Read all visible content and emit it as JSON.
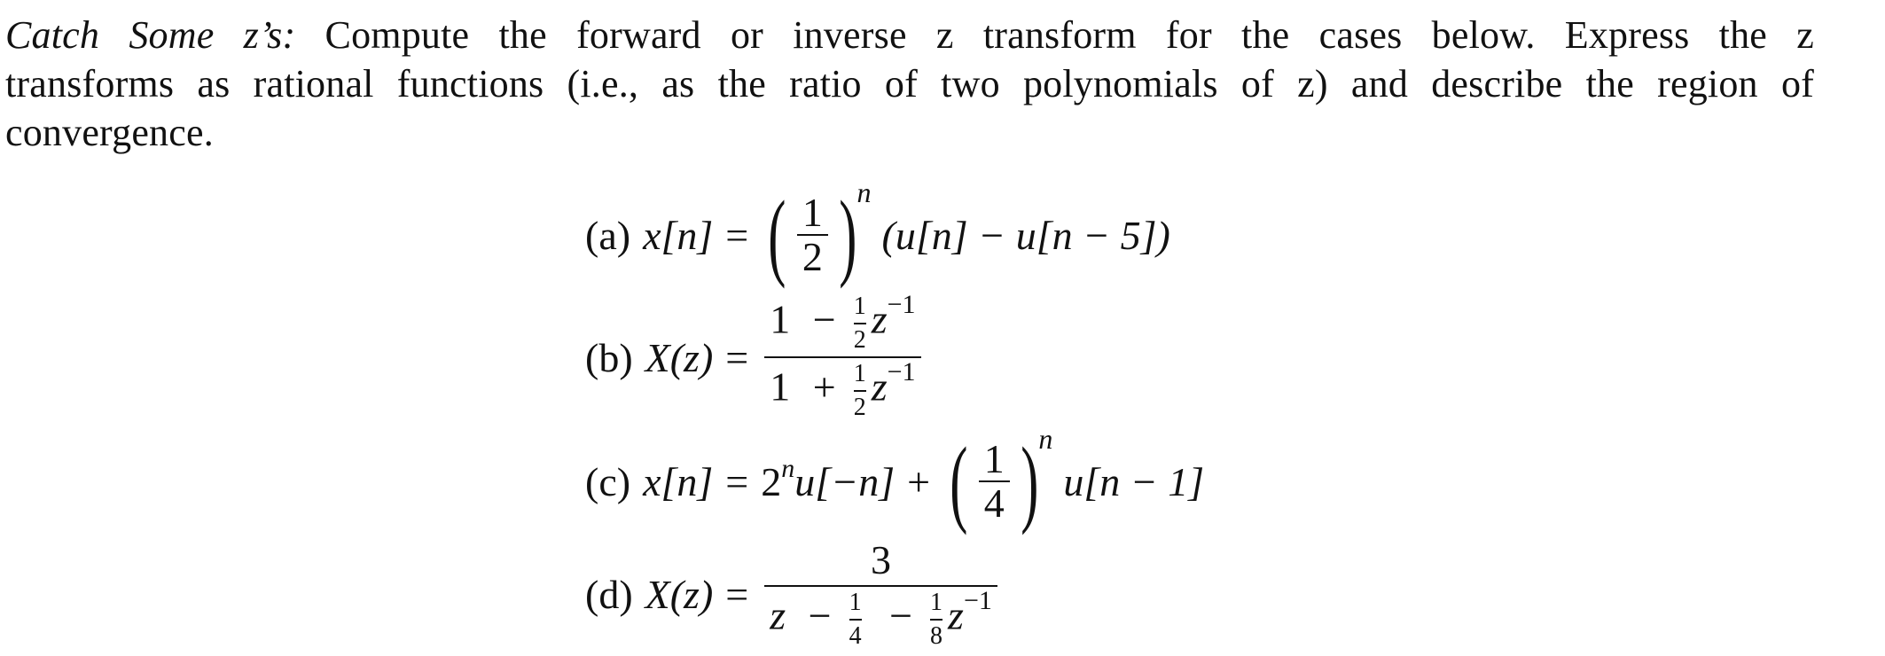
{
  "problem": {
    "lead_title": "Catch Some z’s:",
    "intro_lines": [
      "Compute the forward or inverse z transform for the cases below.  Express the z",
      "transforms as rational functions (i.e., as the ratio of two polynomials of z) and describe the region of",
      "convergence."
    ]
  },
  "parts": {
    "a": {
      "label": "(a)",
      "lhs": "x[n]",
      "equals": "=",
      "base_num": "1",
      "base_den": "2",
      "exponent": "n",
      "rest": "(u[n] − u[n − 5])"
    },
    "b": {
      "label": "(b)",
      "lhs": "X(z)",
      "equals": "=",
      "num_lead": "1",
      "num_op": "−",
      "num_frac_num": "1",
      "num_frac_den": "2",
      "num_var": "z",
      "num_exp": "−1",
      "den_lead": "1",
      "den_op": "+",
      "den_frac_num": "1",
      "den_frac_den": "2",
      "den_var": "z",
      "den_exp": "−1"
    },
    "c": {
      "label": "(c)",
      "lhs": "x[n]",
      "equals": "=",
      "term1_base": "2",
      "term1_exp": "n",
      "term1_rest": "u[−n]",
      "plus": "+",
      "base_num": "1",
      "base_den": "4",
      "exponent": "n",
      "term2_rest": "u[n − 1]"
    },
    "d": {
      "label": "(d)",
      "lhs": "X(z)",
      "equals": "=",
      "numerator": "3",
      "den_var1": "z",
      "den_op1": "−",
      "den_frac1_num": "1",
      "den_frac1_den": "4",
      "den_op2": "−",
      "den_frac2_num": "1",
      "den_frac2_den": "8",
      "den_var2": "z",
      "den_exp": "−1"
    }
  }
}
